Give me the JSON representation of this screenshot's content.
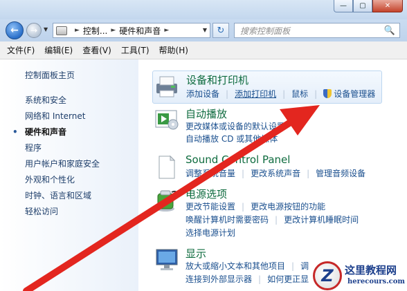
{
  "window": {
    "minimize_glyph": "—",
    "maximize_glyph": "▢",
    "close_glyph": "✕"
  },
  "nav": {
    "back_glyph": "←",
    "forward_glyph": "→",
    "breadcrumb": [
      "控制...",
      "硬件和声音"
    ],
    "search_placeholder": "搜索控制面板",
    "refresh_glyph": "↻",
    "search_glyph": "🔍"
  },
  "menu": [
    "文件(F)",
    "编辑(E)",
    "查看(V)",
    "工具(T)",
    "帮助(H)"
  ],
  "sidebar": {
    "home": "控制面板主页",
    "items": [
      {
        "label": "系统和安全",
        "active": false
      },
      {
        "label": "网络和 Internet",
        "active": false
      },
      {
        "label": "硬件和声音",
        "active": true
      },
      {
        "label": "程序",
        "active": false
      },
      {
        "label": "用户帐户和家庭安全",
        "active": false
      },
      {
        "label": "外观和个性化",
        "active": false
      },
      {
        "label": "时钟、语言和区域",
        "active": false
      },
      {
        "label": "轻松访问",
        "active": false
      }
    ]
  },
  "categories": {
    "devices": {
      "title": "设备和打印机",
      "icon": "printer-icon",
      "links": [
        "添加设备",
        "添加打印机",
        "鼠标",
        "设备管理器"
      ]
    },
    "autoplay": {
      "title": "自动播放",
      "icon": "autoplay-icon",
      "links_row1": [
        "更改媒体或设备的默认设置"
      ],
      "links_row2": [
        "自动播放 CD 或其他媒体"
      ]
    },
    "sound": {
      "title": "Sound Control Panel",
      "icon": "document-icon",
      "links": [
        "调整系统音量",
        "更改系统声音",
        "管理音频设备"
      ]
    },
    "power": {
      "title": "电源选项",
      "icon": "battery-icon",
      "links_row1": [
        "更改节能设置",
        "更改电源按钮的功能"
      ],
      "links_row2": [
        "唤醒计算机时需要密码",
        "更改计算机睡眠时间"
      ],
      "links_row3": [
        "选择电源计划"
      ]
    },
    "display": {
      "title": "显示",
      "icon": "monitor-icon",
      "links_row1": [
        "放大或缩小文本和其他项目",
        "调"
      ],
      "links_row2": [
        "连接到外部显示器",
        "如何更正显"
      ]
    }
  },
  "watermark": {
    "logo_letter": "Z",
    "name": "这里教程网",
    "url": "herecours.com"
  },
  "colors": {
    "arrow": "#e3261f",
    "category_title": "#0e6b3e",
    "link": "#1a4f8e"
  }
}
